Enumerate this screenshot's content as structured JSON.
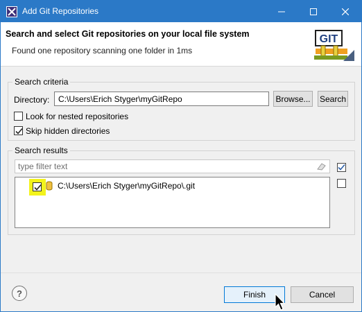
{
  "window": {
    "title": "Add Git Repositories",
    "controls": {
      "minimize": "minimize-icon",
      "maximize": "maximize-icon",
      "close": "close-icon"
    }
  },
  "banner": {
    "title": "Search and select Git repositories on your local file system",
    "message": "Found one repository scanning one folder in 1ms",
    "logo_text": "GIT"
  },
  "criteria": {
    "group_label": "Search criteria",
    "directory_label": "Directory:",
    "directory_value": "C:\\Users\\Erich Styger\\myGitRepo",
    "browse_label": "Browse...",
    "search_label": "Search",
    "nested_label": "Look for nested repositories",
    "nested_checked": false,
    "skip_hidden_label": "Skip hidden directories",
    "skip_hidden_checked": true
  },
  "results": {
    "group_label": "Search results",
    "filter_placeholder": "type filter text",
    "items": [
      {
        "path": "C:\\Users\\Erich Styger\\myGitRepo\\.git",
        "checked": true
      }
    ],
    "select_all_icon": "select-all-icon",
    "deselect_all_icon": "deselect-all-icon"
  },
  "footer": {
    "help_label": "?",
    "finish_label": "Finish",
    "cancel_label": "Cancel"
  },
  "colors": {
    "titlebar": "#2b79c7",
    "highlight": "#f3f31c",
    "default_button_border": "#0078d7"
  }
}
